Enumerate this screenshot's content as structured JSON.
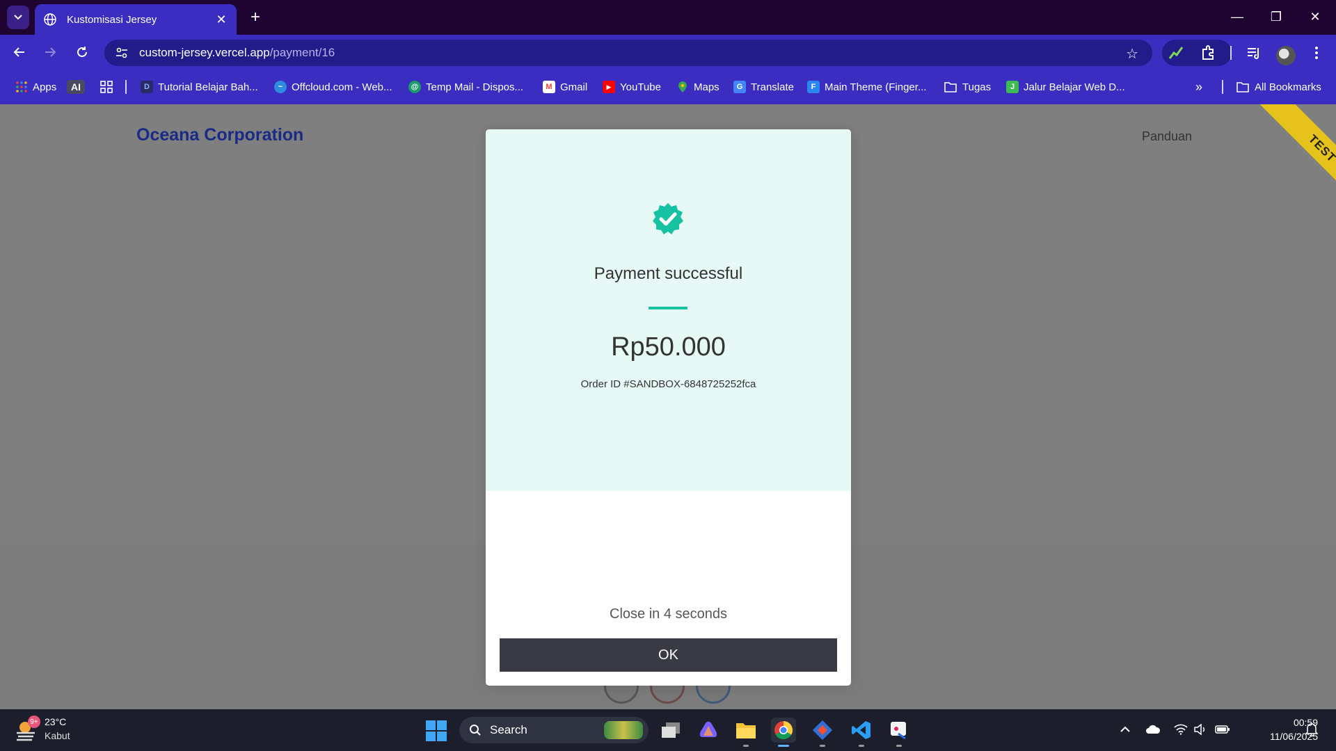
{
  "browser": {
    "tab_title": "Kustomisasi Jersey",
    "url_host": "custom-jersey.vercel.app",
    "url_path": "/payment/16",
    "bookmarks": [
      {
        "label": "Apps",
        "icon": "apps-grid-icon"
      },
      {
        "label": "AI",
        "icon": "ai-badge-icon"
      },
      {
        "label": "",
        "icon": "grid-icon"
      },
      {
        "label": "Tutorial Belajar Bah...",
        "icon": "site-favicon-icon"
      },
      {
        "label": "Offcloud.com - Web...",
        "icon": "offcloud-icon"
      },
      {
        "label": "Temp Mail - Dispos...",
        "icon": "tempmail-icon"
      },
      {
        "label": "Gmail",
        "icon": "gmail-icon"
      },
      {
        "label": "YouTube",
        "icon": "youtube-icon"
      },
      {
        "label": "Maps",
        "icon": "maps-icon"
      },
      {
        "label": "Translate",
        "icon": "translate-icon"
      },
      {
        "label": "Main Theme (Finger...",
        "icon": "doc-icon"
      },
      {
        "label": "Tugas",
        "icon": "folder-icon"
      },
      {
        "label": "Jalur Belajar Web D...",
        "icon": "site-favicon-icon"
      }
    ],
    "all_bookmarks": "All Bookmarks"
  },
  "page": {
    "brand": "Oceana Corporation",
    "nav_link": "Panduan",
    "ribbon": "TEST"
  },
  "modal": {
    "title": "Payment successful",
    "amount": "Rp50.000",
    "order_id": "Order ID #SANDBOX-6848725252fca",
    "close_text": "Close in 4 seconds",
    "ok_label": "OK",
    "accent_color": "#17c2a3"
  },
  "taskbar": {
    "weather_badge": "9+",
    "weather_temp": "23°C",
    "weather_desc": "Kabut",
    "search_label": "Search",
    "clock_time": "00:59",
    "clock_date": "11/06/2025"
  }
}
